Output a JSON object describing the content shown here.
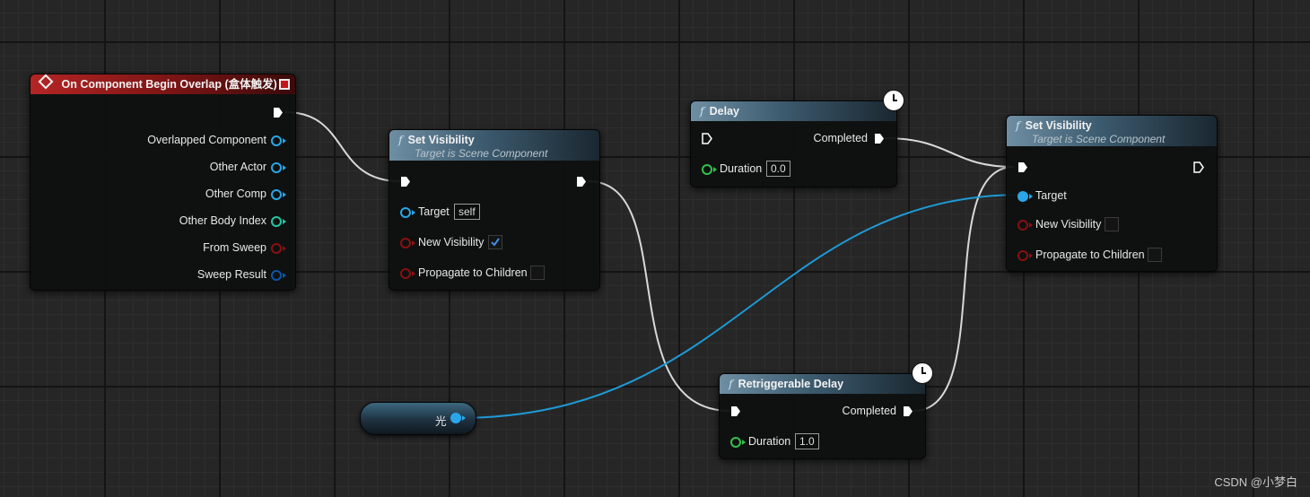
{
  "event_node": {
    "title": "On Component Begin Overlap (盒体触发)",
    "outputs": [
      "Overlapped Component",
      "Other Actor",
      "Other Comp",
      "Other Body Index",
      "From Sweep",
      "Sweep Result"
    ]
  },
  "set_visibility_1": {
    "title": "Set Visibility",
    "subtitle": "Target is Scene Component",
    "target_label": "Target",
    "target_value": "self",
    "new_visibility_label": "New Visibility",
    "new_visibility_checked": true,
    "propagate_label": "Propagate to Children",
    "propagate_checked": false
  },
  "delay_node": {
    "title": "Delay",
    "completed_label": "Completed",
    "duration_label": "Duration",
    "duration_value": "0.0"
  },
  "set_visibility_2": {
    "title": "Set Visibility",
    "subtitle": "Target is Scene Component",
    "target_label": "Target",
    "new_visibility_label": "New Visibility",
    "new_visibility_checked": false,
    "propagate_label": "Propagate to Children",
    "propagate_checked": false
  },
  "retrigger_node": {
    "title": "Retriggerable Delay",
    "completed_label": "Completed",
    "duration_label": "Duration",
    "duration_value": "1.0"
  },
  "variable_node": {
    "name": "光"
  },
  "watermark": "CSDN @小梦白",
  "colors": {
    "exec_wire": "#d8d8d8",
    "object_wire": "#1e9ad6",
    "event_header": "#9b1b1b",
    "function_header": "#4e6f85"
  }
}
